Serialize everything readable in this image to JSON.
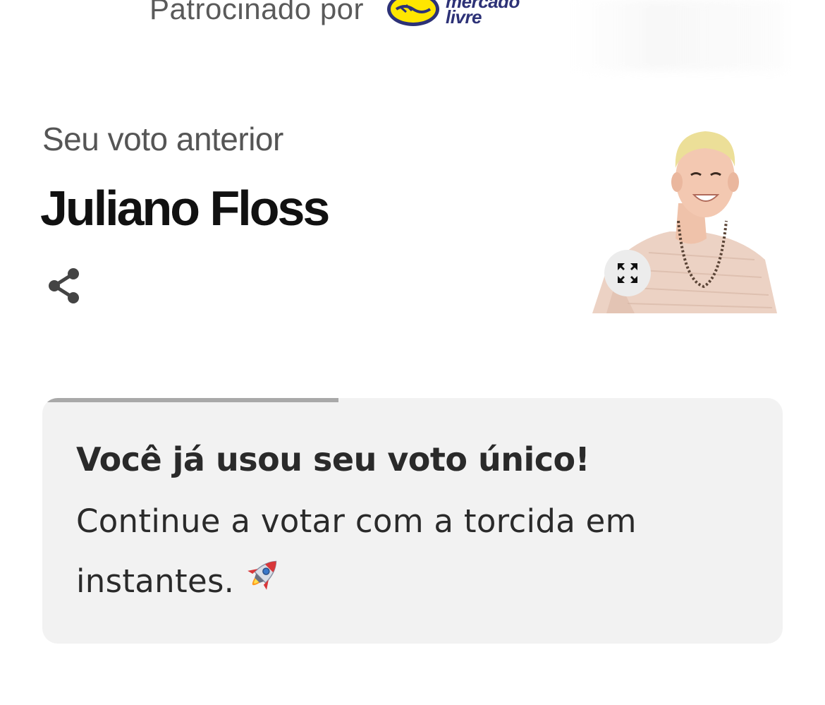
{
  "sponsor": {
    "label": "Patrocinado por",
    "logo_word": "mercado\nlivre",
    "logo_icon": "handshake-icon",
    "logo_color": "#2d3277",
    "logo_accent": "#ffe600"
  },
  "previous_vote": {
    "label": "Seu voto anterior",
    "candidate_name": "Juliano Floss",
    "share_icon": "share-icon",
    "expand_icon": "expand-icon"
  },
  "notice": {
    "title": "Você já usou seu voto único!",
    "body": "Continue a votar com a torcida em instantes.",
    "emoji_icon": "rocket-icon",
    "progress": 0.4,
    "background": "#f2f2f2",
    "progress_color": "#a9a9a9"
  }
}
